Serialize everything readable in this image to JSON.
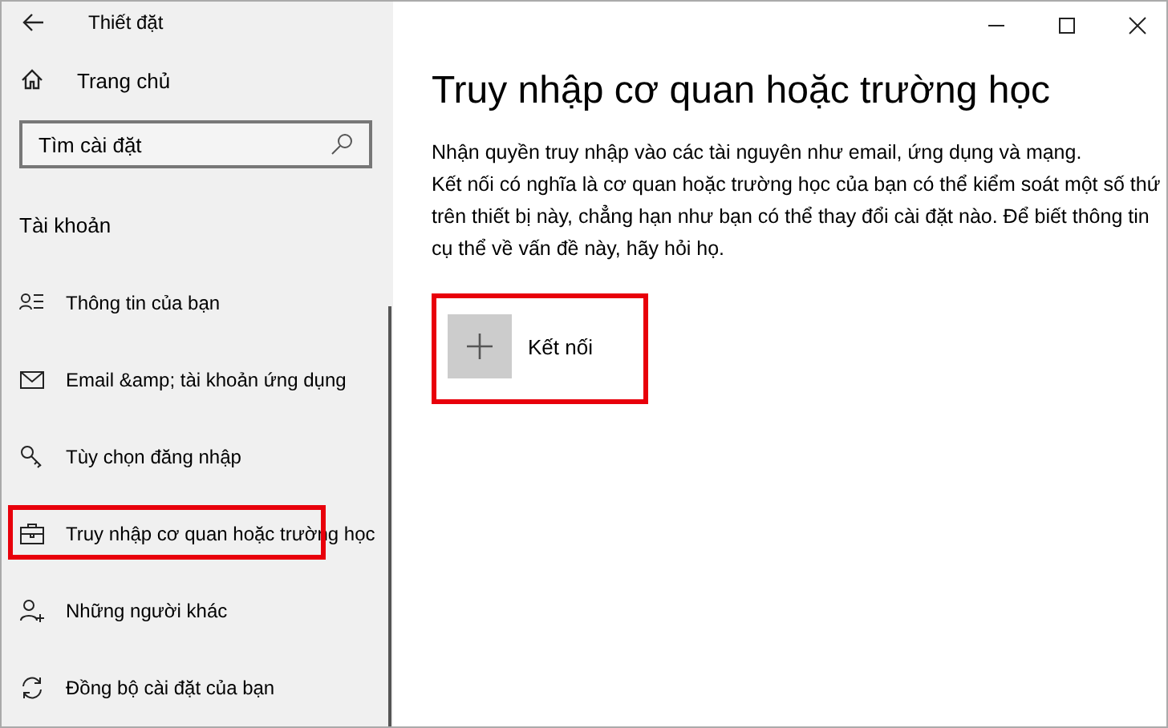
{
  "window": {
    "title": "Thiết đặt",
    "controls": [
      {
        "kind": "minimize"
      },
      {
        "kind": "maximize"
      },
      {
        "kind": "close"
      }
    ]
  },
  "sidebar": {
    "home": {
      "label": "Trang chủ"
    },
    "search": {
      "placeholder": "Tìm cài đặt"
    },
    "section": "Tài khoản",
    "items": [
      {
        "kind": "info",
        "label": "Thông tin của bạn",
        "highlighted": false
      },
      {
        "kind": "email",
        "label": "Email &amp; tài khoản ứng dụng",
        "highlighted": false
      },
      {
        "kind": "key",
        "label": "Tùy chọn đăng nhập",
        "highlighted": false
      },
      {
        "kind": "briefcase",
        "label": "Truy nhập cơ quan hoặc trường học",
        "highlighted": true
      },
      {
        "kind": "person-add",
        "label": "Những người khác",
        "highlighted": false
      },
      {
        "kind": "sync",
        "label": "Đồng bộ cài đặt của bạn",
        "highlighted": false
      }
    ]
  },
  "main": {
    "heading": "Truy nhập cơ quan hoặc trường học",
    "paragraphs": [
      "Nhận quyền truy nhập vào các tài nguyên như email, ứng dụng và mạng.",
      "Kết nối có nghĩa là cơ quan hoặc trường học của bạn có thể kiểm soát một số thứ trên thiết bị này, chẳng hạn như bạn có thể thay đổi cài đặt nào. Để biết thông tin cụ thể về vấn đề này, hãy hỏi họ."
    ],
    "connect": {
      "label": "Kết nối",
      "highlighted": true
    }
  }
}
